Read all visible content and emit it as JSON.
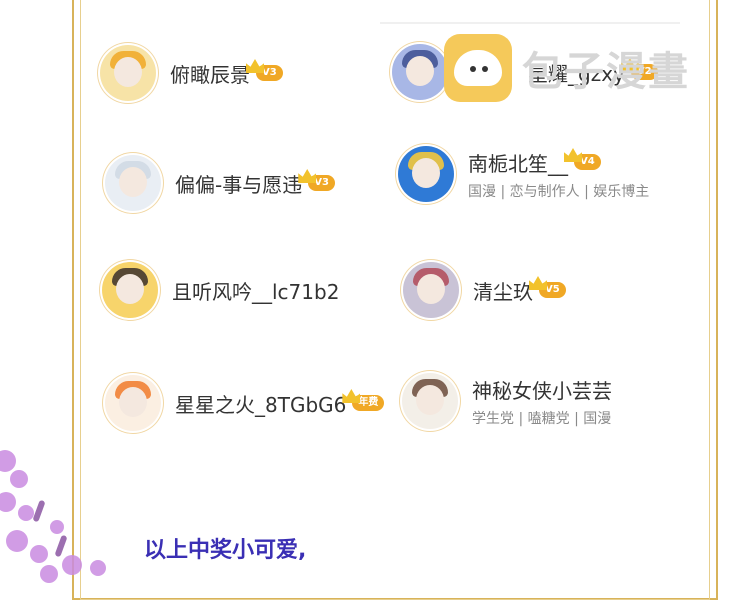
{
  "users": [
    {
      "id": "u1",
      "name": "俯瞰辰景",
      "badge": "V3",
      "tags": ""
    },
    {
      "id": "u2",
      "name": "星耀_gzxy",
      "badge": "V2",
      "tags": ""
    },
    {
      "id": "u3",
      "name": "偏偏-事与愿违",
      "badge": "V3",
      "tags": ""
    },
    {
      "id": "u4",
      "name": "南栀北笙__",
      "badge": "V4",
      "tags": "国漫 | 恋与制作人 | 娱乐博主"
    },
    {
      "id": "u5",
      "name": "且听风吟__lc71b2",
      "badge": "",
      "tags": ""
    },
    {
      "id": "u6",
      "name": "清尘玖",
      "badge": "V5",
      "tags": ""
    },
    {
      "id": "u7",
      "name": "星星之火_8TGbG6",
      "badge": "年费",
      "tags": ""
    },
    {
      "id": "u8",
      "name": "神秘女侠小芸芸",
      "badge": "",
      "tags": "学生党 | 嗑糖党 | 国漫"
    }
  ],
  "watermark": {
    "text": "包子漫畫"
  },
  "footer": {
    "text": "以上中奖小可爱,"
  },
  "colors": {
    "frame": "#d8b35a",
    "footer": "#3a2fb4",
    "badge": "#f0a825"
  }
}
